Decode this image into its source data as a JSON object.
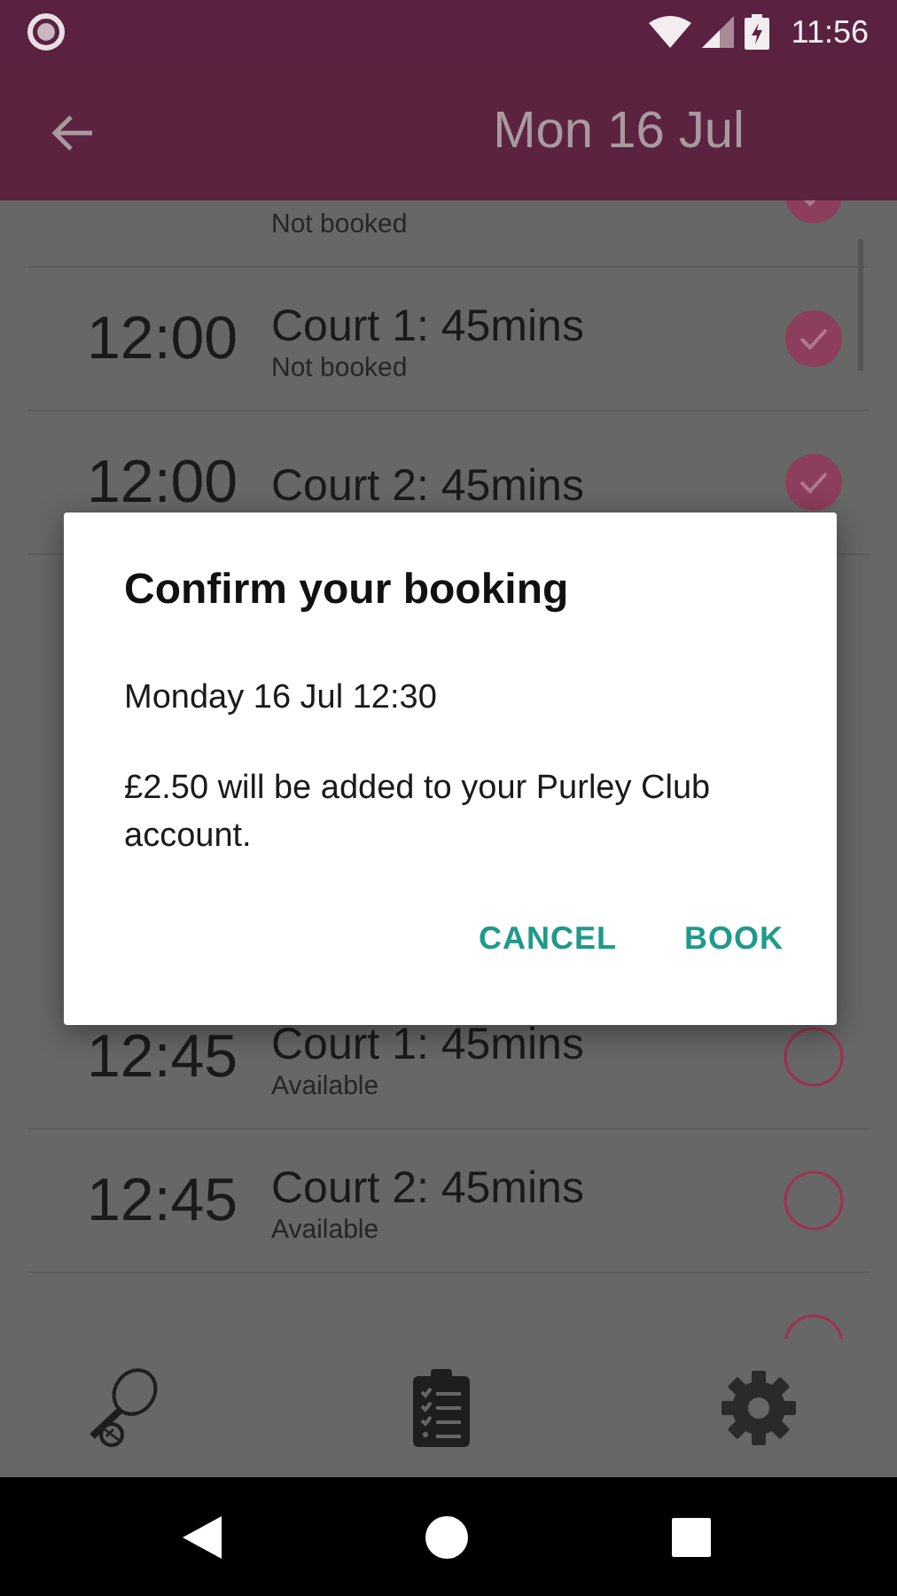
{
  "status_bar": {
    "time": "11:56"
  },
  "app_bar": {
    "title": "Mon 16 Jul"
  },
  "slots": [
    {
      "status": "Not booked",
      "checked": true
    },
    {
      "time": "12:00",
      "court": "Court 1: 45mins",
      "status": "Not booked",
      "checked": true
    },
    {
      "time": "12:00",
      "court": "Court 2: 45mins",
      "checked": true
    },
    {
      "time": "12:45",
      "court": "Court 1: 45mins",
      "status": "Available",
      "checked": false
    },
    {
      "time": "12:45",
      "court": "Court 2: 45mins",
      "status": "Available",
      "checked": false
    },
    {
      "checked": false
    }
  ],
  "dialog": {
    "title": "Confirm your booking",
    "date": "Monday 16 Jul 12:30",
    "message": "£2.50 will be added to your Purley Club account.",
    "buttons": [
      "CANCEL",
      "BOOK"
    ]
  }
}
